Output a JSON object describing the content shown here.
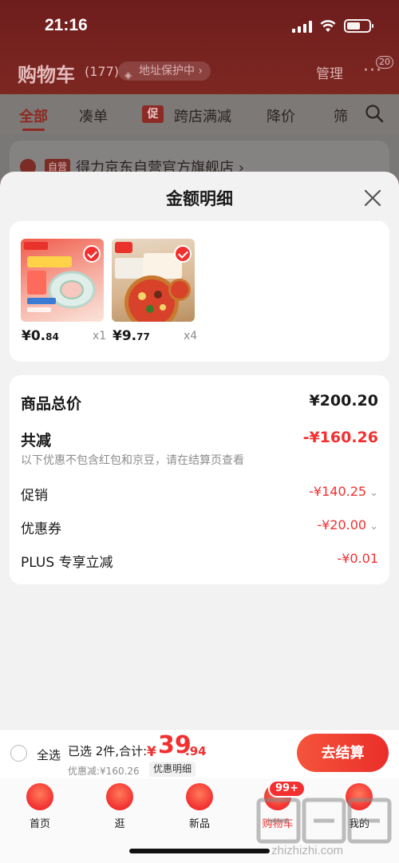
{
  "status_bar": {
    "time": "21:16"
  },
  "cart_header": {
    "title": "购物车",
    "count": "(177)",
    "address_protect": "地址保护中",
    "manage": "管理",
    "message_badge": "20"
  },
  "filter_tabs": {
    "all": "全部",
    "bundle": "凑单",
    "promo_tag": "促",
    "cross_store": "跨店满减",
    "price_drop": "降价",
    "filter": "筛"
  },
  "store": {
    "tag": "自营",
    "name": "得力京东自营官方旗舰店 ›"
  },
  "sheet": {
    "title": "金额明细",
    "goods": [
      {
        "price_int": "¥0.",
        "price_dec": "84",
        "qty": "x1",
        "image": "tape-product"
      },
      {
        "price_int": "¥9.",
        "price_dec": "77",
        "qty": "x4",
        "image": "pizza-product"
      }
    ],
    "rows": {
      "total_label": "商品总价",
      "total_value": "¥200.20",
      "reduce_label": "共减",
      "reduce_value": "-¥160.26",
      "reduce_note": "以下优惠不包含红包和京豆，请在结算页查看",
      "promo_label": "促销",
      "promo_value": "-¥140.25",
      "coupon_label": "优惠券",
      "coupon_value": "-¥20.00",
      "plus_label": "PLUS 专享立减",
      "plus_value": "-¥0.01"
    }
  },
  "checkout": {
    "select_all": "全选",
    "selected_text": "已选 2件,合计:",
    "yen": "¥",
    "total_int": "39",
    "total_dec": ".94",
    "discount_text": "优惠减:¥160.26",
    "detail_link": "优惠明细",
    "button": "去结算"
  },
  "tabs": {
    "home": "首页",
    "browse": "逛",
    "new": "新品",
    "cart": "购物车",
    "cart_badge": "99+",
    "mine": "我的"
  },
  "watermark": "zhizhizhi.com",
  "colors": {
    "accent": "#f23030",
    "sheet_bg": "#f2f2f2"
  }
}
